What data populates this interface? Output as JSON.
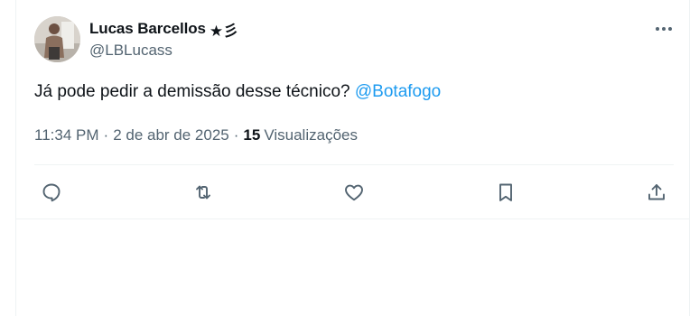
{
  "author": {
    "name": "Lucas Barcellos",
    "name_emoji": "★彡",
    "handle": "@LBLucass"
  },
  "tweet": {
    "text": "Já pode pedir a demissão desse técnico?",
    "mention": "@Botafogo"
  },
  "meta": {
    "time": "11:34 PM",
    "separator": "·",
    "date": "2 de abr de 2025",
    "views_count": "15",
    "views_label": "Visualizações"
  },
  "icons": {
    "more": "more-dots-icon",
    "reply": "reply-icon",
    "retweet": "retweet-icon",
    "like": "heart-icon",
    "bookmark": "bookmark-icon",
    "share": "share-icon"
  },
  "colors": {
    "text_primary": "#0f1419",
    "text_secondary": "#536471",
    "accent": "#1d9bf0",
    "divider": "#eff3f4"
  }
}
